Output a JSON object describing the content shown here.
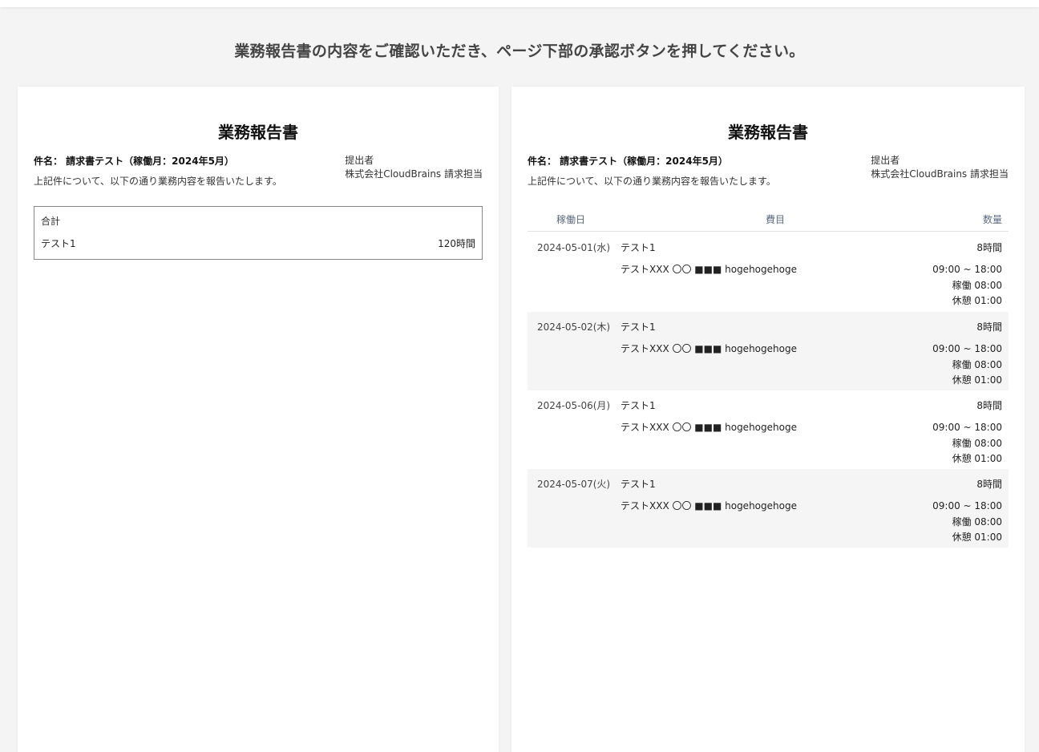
{
  "instruction": "業務報告書の内容をご確認いただき、ページ下部の承認ボタンを押してください。",
  "summary_report": {
    "title": "業務報告書",
    "subject": "件名： 請求書テスト（稼働月：2024年5月）",
    "lead": "上記件について、以下の通り業務内容を報告いたします。",
    "submitter_label": "提出者",
    "submitter_name": "株式会社CloudBrains 請求担当",
    "total_label": "合計",
    "rows": [
      {
        "item": "テスト1",
        "quantity": "120時間"
      }
    ]
  },
  "detail_report": {
    "title": "業務報告書",
    "subject": "件名： 請求書テスト（稼働月：2024年5月）",
    "lead": "上記件について、以下の通り業務内容を報告いたします。",
    "submitter_label": "提出者",
    "submitter_name": "株式会社CloudBrains 請求担当",
    "columns": {
      "date": "稼働日",
      "item": "費目",
      "quantity": "数量"
    },
    "days": [
      {
        "date": "2024-05-01(水)",
        "item": "テスト1",
        "hours": "8時間",
        "detail": "テストXXX 〇〇 ■■■ hogehogehoge",
        "time_range": "09:00 ~ 18:00",
        "work": "稼働 08:00",
        "break": "休憩 01:00"
      },
      {
        "date": "2024-05-02(木)",
        "item": "テスト1",
        "hours": "8時間",
        "detail": "テストXXX 〇〇 ■■■ hogehogehoge",
        "time_range": "09:00 ~ 18:00",
        "work": "稼働 08:00",
        "break": "休憩 01:00"
      },
      {
        "date": "2024-05-06(月)",
        "item": "テスト1",
        "hours": "8時間",
        "detail": "テストXXX 〇〇 ■■■ hogehogehoge",
        "time_range": "09:00 ~ 18:00",
        "work": "稼働 08:00",
        "break": "休憩 01:00"
      },
      {
        "date": "2024-05-07(火)",
        "item": "テスト1",
        "hours": "8時間",
        "detail": "テストXXX 〇〇 ■■■ hogehogehoge",
        "time_range": "09:00 ~ 18:00",
        "work": "稼働 08:00",
        "break": "休憩 01:00"
      }
    ]
  }
}
